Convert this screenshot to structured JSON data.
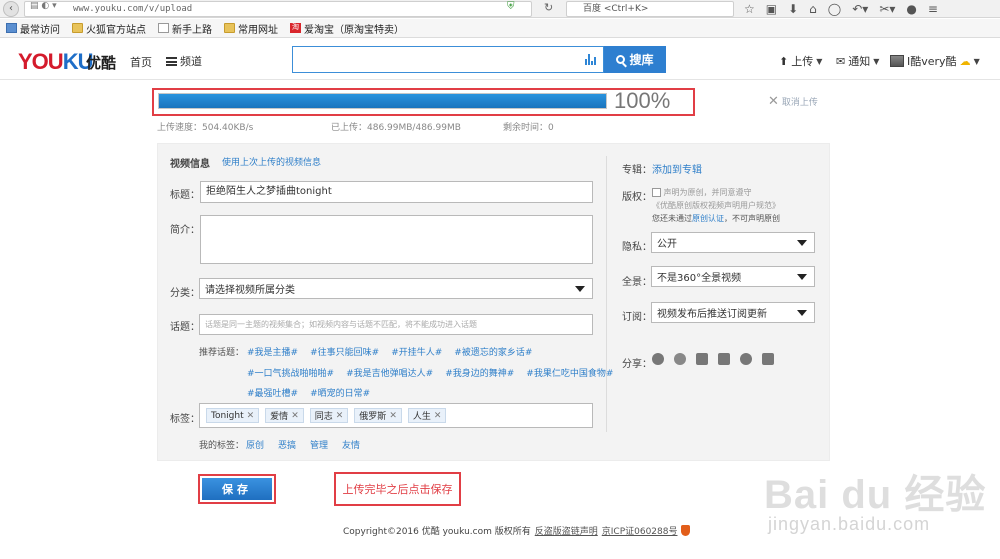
{
  "browser": {
    "url": "www.youku.com/v/upload",
    "search_placeholder": "百度 <Ctrl+K>",
    "bookmarks": [
      {
        "label": "最常访问",
        "icon": "bookmark-icon"
      },
      {
        "label": "火狐官方站点",
        "icon": "folder-icon"
      },
      {
        "label": "新手上路",
        "icon": "page-icon"
      },
      {
        "label": "常用网址",
        "icon": "folder-icon"
      },
      {
        "label": "爱淘宝（原淘宝特卖）",
        "icon": "taobao-icon"
      }
    ]
  },
  "header": {
    "logo_en_1": "YOU",
    "logo_en_2": "KU",
    "logo_cn": "优酷",
    "nav_home": "首页",
    "nav_channel": "频道",
    "search_button": "搜库",
    "upload": "上传",
    "notify": "通知",
    "user": "I酷very酷"
  },
  "upload": {
    "progress_percent": 100,
    "progress_text": "100%",
    "cancel": "取消上传",
    "speed": "上传速度：504.40KB/s",
    "uploaded": "已上传：486.99MB/486.99MB",
    "remaining": "剩余时间：0"
  },
  "form": {
    "section_title": "视频信息",
    "reuse_link": "使用上次上传的视频信息",
    "title_label": "标题：",
    "title_value": "拒绝陌生人之梦插曲tonight",
    "intro_label": "简介：",
    "category_label": "分类：",
    "category_value": "请选择视频所属分类",
    "topic_label": "话题：",
    "topic_placeholder": "话题是同一主题的视频集合；如视频内容与话题不匹配，将不能成功进入话题",
    "recommend_label": "推荐话题：",
    "topics_row1": [
      "#我是主播#",
      "#往事只能回味#",
      "#开挂牛人#",
      "#被遗忘的家乡话#"
    ],
    "topics_row2": [
      "#一口气挑战啪啪啪#",
      "#我是吉他弹唱达人#",
      "#我身边的舞神#",
      "#我果仁吃中国食物#"
    ],
    "topics_row3": [
      "#最强吐槽#",
      "#晒宠的日常#"
    ],
    "tags_label": "标签：",
    "tags": [
      "Tonight",
      "爱情",
      "同志",
      "俄罗斯",
      "人生"
    ],
    "my_tags_label": "我的标签：",
    "my_tags": [
      "原创",
      "恶搞",
      "管理",
      "友情"
    ]
  },
  "side": {
    "album_label": "专辑：",
    "album_link": "添加到专辑",
    "copyright_label": "版权：",
    "copyright_text1": "声明为原创，并同意遵守",
    "copyright_text2": "《优酷原创版权视频声明用户规范》",
    "copyright_text3": "您还未通过",
    "copyright_link": "原创认证",
    "copyright_text4": "，不可声明原创",
    "privacy_label": "隐私：",
    "privacy_value": "公开",
    "panorama_label": "全景：",
    "panorama_value": "不是360°全景视频",
    "subscribe_label": "订阅：",
    "subscribe_value": "视频发布后推送订阅更新",
    "share_label": "分享："
  },
  "actions": {
    "save": "保存",
    "note": "上传完毕之后点击保存"
  },
  "footer": {
    "copyright": "Copyright©2016 优酷 youku.com 版权所有",
    "links": [
      "反盗版盗链声明",
      "京ICP证060288号"
    ]
  },
  "watermark": {
    "brand": "Bai du 经验",
    "url": "jingyan.baidu.com"
  }
}
